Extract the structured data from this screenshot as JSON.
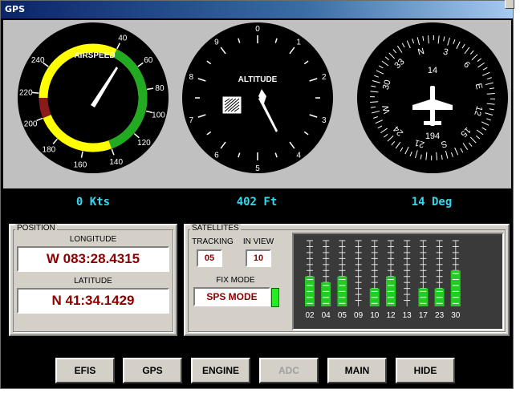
{
  "window": {
    "title": "GPS"
  },
  "gauges": {
    "airspeed": {
      "label": "AIRSPEED",
      "ticks": [
        "40",
        "60",
        "80",
        "100",
        "120",
        "140",
        "160",
        "180",
        "200",
        "220",
        "240"
      ]
    },
    "altitude": {
      "label": "ALTITUDE",
      "ticks": [
        "0",
        "1",
        "2",
        "3",
        "4",
        "5",
        "6",
        "7",
        "8",
        "9"
      ]
    },
    "heading": {
      "top_value": "14",
      "bottom_value": "194",
      "labels": [
        "N",
        "3",
        "6",
        "E",
        "12",
        "15",
        "S",
        "21",
        "24",
        "W",
        "30",
        "33"
      ]
    }
  },
  "readouts": {
    "speed": "0 Kts",
    "altitude": "402 Ft",
    "heading": "14 Deg"
  },
  "position": {
    "legend": "POSITION",
    "longitude_label": "LONGITUDE",
    "longitude": "W 083:28.4315",
    "latitude_label": "LATITUDE",
    "latitude": "N 41:34.1429"
  },
  "satellites": {
    "legend": "SATELLITES",
    "tracking_label": "TRACKING",
    "tracking": "05",
    "inview_label": "IN VIEW",
    "inview": "10",
    "fixmode_label": "FIX MODE",
    "fixmode": "SPS MODE",
    "ids": [
      "02",
      "04",
      "05",
      "09",
      "10",
      "12",
      "13",
      "17",
      "23",
      "30"
    ],
    "signal_levels": [
      0.45,
      0.4,
      0.45,
      0.0,
      0.25,
      0.45,
      0.0,
      0.3,
      0.25,
      0.5
    ]
  },
  "buttons": {
    "efis": "EFIS",
    "gps": "GPS",
    "engine": "ENGINE",
    "adc": "ADC",
    "main": "MAIN",
    "hide": "HIDE"
  },
  "colors": {
    "readout": "#32d8ee",
    "value_text": "#8b0000",
    "signal": "#22cc22",
    "airspeed_red": "#8b1a1a",
    "airspeed_yellow": "#ffff00",
    "airspeed_green": "#22aa22"
  }
}
